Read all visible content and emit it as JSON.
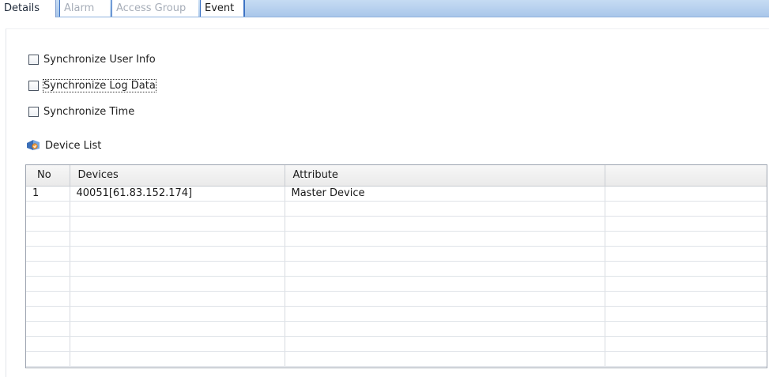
{
  "tabs": [
    {
      "label": "Details",
      "state": "active"
    },
    {
      "label": "Alarm",
      "state": "disabled"
    },
    {
      "label": "Access Group",
      "state": "disabled"
    },
    {
      "label": "Event",
      "state": "enabled"
    }
  ],
  "options": {
    "sync_user_info": {
      "label": "Synchronize User Info",
      "checked": false
    },
    "sync_log_data": {
      "label": "Synchronize Log Data",
      "checked": false
    },
    "sync_time": {
      "label": "Synchronize Time",
      "checked": false
    }
  },
  "device_list": {
    "title": "Device List",
    "icon": "device-list-icon",
    "columns": [
      "No",
      "Devices",
      "Attribute",
      ""
    ],
    "rows": [
      [
        "1",
        "40051[61.83.152.174]",
        "Master Device",
        ""
      ],
      [
        "",
        "",
        "",
        ""
      ],
      [
        "",
        "",
        "",
        ""
      ],
      [
        "",
        "",
        "",
        ""
      ],
      [
        "",
        "",
        "",
        ""
      ],
      [
        "",
        "",
        "",
        ""
      ],
      [
        "",
        "",
        "",
        ""
      ],
      [
        "",
        "",
        "",
        ""
      ],
      [
        "",
        "",
        "",
        ""
      ],
      [
        "",
        "",
        "",
        ""
      ],
      [
        "",
        "",
        "",
        ""
      ],
      [
        "",
        "",
        "",
        ""
      ]
    ]
  },
  "colors": {
    "tabbar": "#a9c7ea",
    "tab_border": "#3d73c4",
    "disabled_text": "#a6adb8"
  }
}
